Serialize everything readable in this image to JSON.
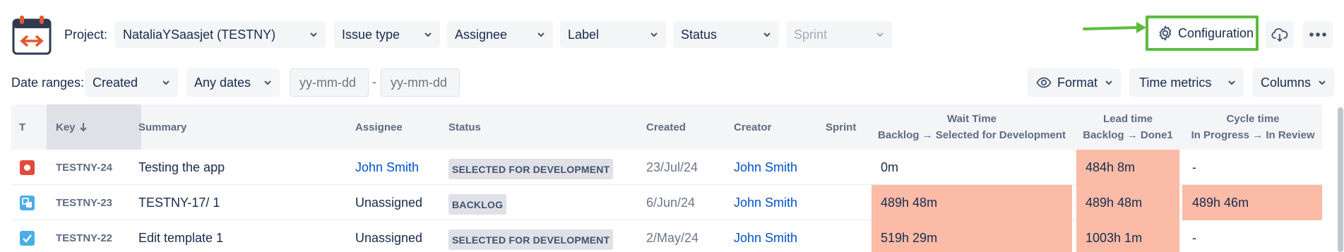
{
  "toolbar": {
    "project_label": "Project:",
    "project_value": "NataliaYSaasjet (TESTNY)",
    "issue_type": "Issue type",
    "assignee": "Assignee",
    "label": "Label",
    "status": "Status",
    "sprint": "Sprint",
    "configuration_label": "Configuration",
    "icons": {
      "logo": "calendar-arrows-icon",
      "config": "gear-icon",
      "cloud": "cloud-download-icon",
      "more": "more-horizontal-icon"
    },
    "annotation_arrow_color": "#5dbb3f"
  },
  "filters": {
    "date_ranges_label": "Date ranges:",
    "date_field": "Created",
    "date_period": "Any dates",
    "from_placeholder": "yy-mm-dd",
    "separator": "-",
    "to_placeholder": "yy-mm-dd",
    "format_label": "Format",
    "time_metrics_label": "Time metrics",
    "columns_label": "Columns"
  },
  "table": {
    "headers": {
      "type": "T",
      "key": "Key",
      "summary": "Summary",
      "assignee": "Assignee",
      "status": "Status",
      "created": "Created",
      "creator": "Creator",
      "sprint": "Sprint",
      "wait_time": "Wait Time",
      "wait_time_sub": "Backlog → Selected for Development",
      "lead_time": "Lead time",
      "lead_time_sub": "Backlog → Done1",
      "cycle_time": "Cycle time",
      "cycle_time_sub": "In Progress → In Review"
    },
    "rows": [
      {
        "type_icon": "bug-icon",
        "type_color": "#e5493a",
        "key": "TESTNY-24",
        "summary": "Testing the app",
        "assignee": "John Smith",
        "status": "SELECTED FOR DEVELOPMENT",
        "created": "23/Jul/24",
        "creator": "John Smith",
        "sprint": "",
        "wait_time": "0m",
        "lead_time": "484h 8m",
        "cycle_time": "-"
      },
      {
        "type_icon": "subtask-icon",
        "type_color": "#4bade8",
        "key": "TESTNY-23",
        "summary": "TESTNY-17/ 1",
        "assignee": "Unassigned",
        "status": "BACKLOG",
        "created": "6/Jun/24",
        "creator": "John Smith",
        "sprint": "",
        "wait_time": "489h 48m",
        "lead_time": "489h 48m",
        "cycle_time": "489h 46m"
      },
      {
        "type_icon": "task-icon",
        "type_color": "#4bade8",
        "key": "TESTNY-22",
        "summary": "Edit template 1",
        "assignee": "Unassigned",
        "status": "SELECTED FOR DEVELOPMENT",
        "created": "2/May/24",
        "creator": "John Smith",
        "sprint": "",
        "wait_time": "519h 29m",
        "lead_time": "1003h 1m",
        "cycle_time": "-"
      }
    ],
    "highlight_color": "#fbbba6"
  }
}
